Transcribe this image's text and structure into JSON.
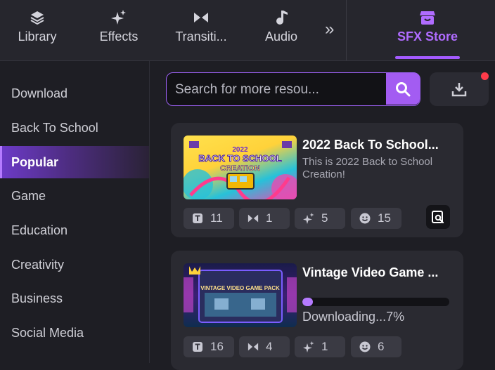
{
  "topbar": {
    "tabs": [
      {
        "label": "Library",
        "icon": "layers-icon"
      },
      {
        "label": "Effects",
        "icon": "sparkles-icon"
      },
      {
        "label": "Transiti...",
        "icon": "transition-icon"
      },
      {
        "label": "Audio",
        "icon": "music-note-icon"
      },
      {
        "label": "SFX Store",
        "icon": "store-icon"
      }
    ],
    "more_icon": "chevron-double-right-icon",
    "accent": "#a45bff"
  },
  "sidebar": {
    "items": [
      "Download",
      "Back To School",
      "Popular",
      "Game",
      "Education",
      "Creativity",
      "Business",
      "Social Media"
    ],
    "active": "Popular"
  },
  "search": {
    "placeholder": "Search for more resou..."
  },
  "cards": [
    {
      "title": "2022 Back To School...",
      "description": "This is 2022 Back to School Creation!",
      "thumb_text_year": "2022",
      "thumb_text_main": "BACK TO SCHOOL",
      "thumb_text_sub": "CREATION",
      "stats": {
        "titles": "11",
        "transitions": "1",
        "effects": "5",
        "stickers": "15"
      }
    },
    {
      "title": "Vintage Video Game ...",
      "download_status": "Downloading...7%",
      "progress": 0.07,
      "thumb_text_main": "VINTAGE VIDEO GAME PACK",
      "stats": {
        "titles": "16",
        "transitions": "4",
        "effects": "1",
        "stickers": "6"
      }
    }
  ]
}
